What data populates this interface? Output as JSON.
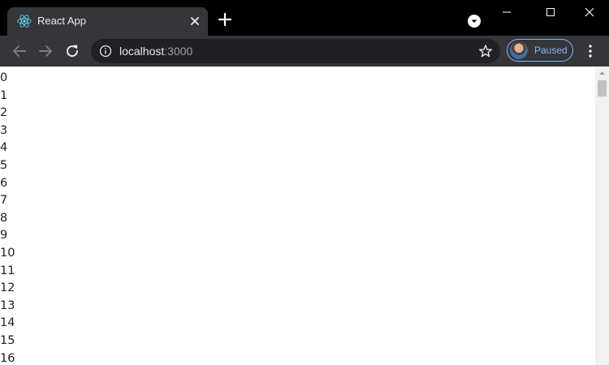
{
  "browser": {
    "tab": {
      "title": "React App",
      "favicon": "react-logo-icon"
    },
    "new_tab_icon": "plus-icon",
    "tab_search_icon": "tab-search-icon",
    "window_controls": [
      "minimize-icon",
      "maximize-icon",
      "close-icon"
    ],
    "toolbar": {
      "back_icon": "back-arrow-icon",
      "forward_icon": "forward-arrow-icon",
      "reload_icon": "reload-icon",
      "site_info_icon": "info-icon",
      "bookmark_icon": "star-icon",
      "menu_icon": "kebab-menu-icon"
    },
    "address": {
      "host": "localhost",
      "port": ":3000"
    },
    "profile": {
      "label": "Paused",
      "accent_color": "#8ab4f8"
    }
  },
  "page": {
    "numbers": [
      "0",
      "1",
      "2",
      "3",
      "4",
      "5",
      "6",
      "7",
      "8",
      "9",
      "10",
      "11",
      "12",
      "13",
      "14",
      "15",
      "16"
    ]
  },
  "colors": {
    "chrome_dark": "#35363a",
    "tabstrip": "#000000",
    "page_background": "#ffffff"
  }
}
